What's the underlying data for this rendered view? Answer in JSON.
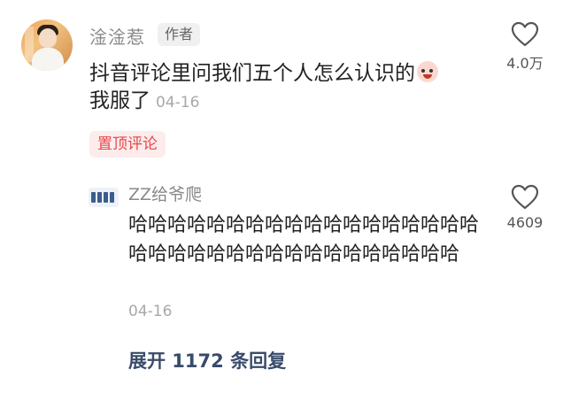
{
  "main_comment": {
    "author": "淦淦惹",
    "badge": "作者",
    "text": "抖音评论里问我们五个人怎么认识的",
    "text_line2": "我服了",
    "date": "04-16",
    "likes": "4.0万",
    "pinned_label": "置顶评论"
  },
  "reply": {
    "author": "ZZ给爷爬",
    "text": "哈哈哈哈哈哈哈哈哈哈哈哈哈哈哈哈哈哈哈哈哈哈哈哈哈哈哈哈哈哈哈哈哈哈哈",
    "date": "04-16",
    "likes": "4609"
  },
  "expand_label": "展开 1172 条回复",
  "icons": {
    "like": "heart-outline-icon",
    "emoji": "crying-face-icon"
  }
}
